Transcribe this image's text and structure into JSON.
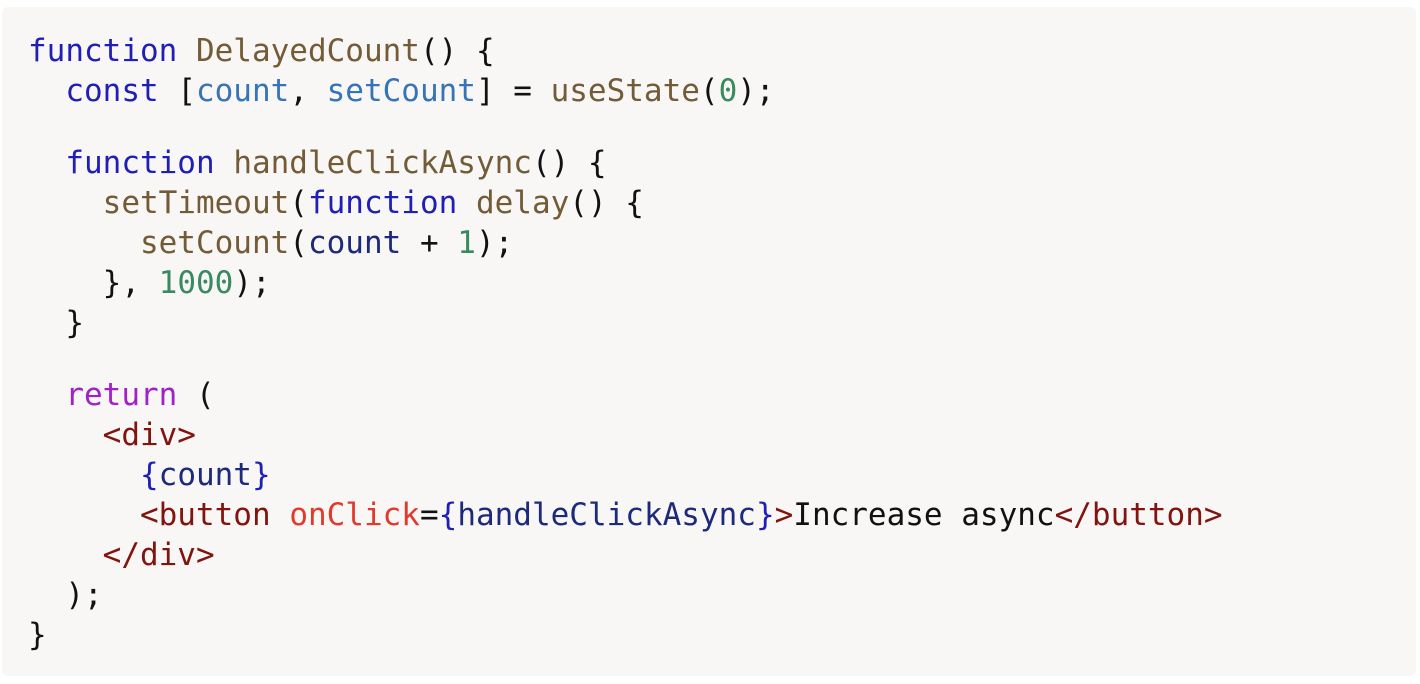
{
  "code": {
    "language": "jsx",
    "lines": [
      [
        {
          "t": "function",
          "c": "kw"
        },
        {
          "t": " ",
          "c": "txt"
        },
        {
          "t": "DelayedCount",
          "c": "fn"
        },
        {
          "t": "() {",
          "c": "txt"
        }
      ],
      [
        {
          "t": "  ",
          "c": "txt"
        },
        {
          "t": "const",
          "c": "kw"
        },
        {
          "t": " [",
          "c": "txt"
        },
        {
          "t": "count",
          "c": "var"
        },
        {
          "t": ", ",
          "c": "txt"
        },
        {
          "t": "setCount",
          "c": "var"
        },
        {
          "t": "] = ",
          "c": "txt"
        },
        {
          "t": "useState",
          "c": "fn"
        },
        {
          "t": "(",
          "c": "txt"
        },
        {
          "t": "0",
          "c": "num"
        },
        {
          "t": ");",
          "c": "txt"
        }
      ],
      "GAP",
      [
        {
          "t": "  ",
          "c": "txt"
        },
        {
          "t": "function",
          "c": "kw"
        },
        {
          "t": " ",
          "c": "txt"
        },
        {
          "t": "handleClickAsync",
          "c": "fn"
        },
        {
          "t": "() {",
          "c": "txt"
        }
      ],
      [
        {
          "t": "    ",
          "c": "txt"
        },
        {
          "t": "setTimeout",
          "c": "fn"
        },
        {
          "t": "(",
          "c": "txt"
        },
        {
          "t": "function",
          "c": "kw"
        },
        {
          "t": " ",
          "c": "txt"
        },
        {
          "t": "delay",
          "c": "fn"
        },
        {
          "t": "() {",
          "c": "txt"
        }
      ],
      [
        {
          "t": "      ",
          "c": "txt"
        },
        {
          "t": "setCount",
          "c": "fn"
        },
        {
          "t": "(",
          "c": "txt"
        },
        {
          "t": "count",
          "c": "ident"
        },
        {
          "t": " + ",
          "c": "txt"
        },
        {
          "t": "1",
          "c": "num"
        },
        {
          "t": ");",
          "c": "txt"
        }
      ],
      [
        {
          "t": "    }, ",
          "c": "txt"
        },
        {
          "t": "1000",
          "c": "num"
        },
        {
          "t": ");",
          "c": "txt"
        }
      ],
      [
        {
          "t": "  }",
          "c": "txt"
        }
      ],
      "GAP",
      [
        {
          "t": "  ",
          "c": "txt"
        },
        {
          "t": "return",
          "c": "ret"
        },
        {
          "t": " (",
          "c": "txt"
        }
      ],
      [
        {
          "t": "    ",
          "c": "txt"
        },
        {
          "t": "<div>",
          "c": "tag"
        }
      ],
      [
        {
          "t": "      ",
          "c": "txt"
        },
        {
          "t": "{",
          "c": "brace"
        },
        {
          "t": "count",
          "c": "ident"
        },
        {
          "t": "}",
          "c": "brace"
        }
      ],
      [
        {
          "t": "      ",
          "c": "txt"
        },
        {
          "t": "<button",
          "c": "tag"
        },
        {
          "t": " ",
          "c": "txt"
        },
        {
          "t": "onClick",
          "c": "attr"
        },
        {
          "t": "=",
          "c": "txt"
        },
        {
          "t": "{",
          "c": "brace"
        },
        {
          "t": "handleClickAsync",
          "c": "ident"
        },
        {
          "t": "}",
          "c": "brace"
        },
        {
          "t": ">",
          "c": "tag"
        },
        {
          "t": "Increase async",
          "c": "txt"
        },
        {
          "t": "</button>",
          "c": "tag"
        }
      ],
      [
        {
          "t": "    ",
          "c": "txt"
        },
        {
          "t": "</div>",
          "c": "tag"
        }
      ],
      [
        {
          "t": "  );",
          "c": "txt"
        }
      ],
      [
        {
          "t": "}",
          "c": "txt"
        }
      ]
    ]
  }
}
